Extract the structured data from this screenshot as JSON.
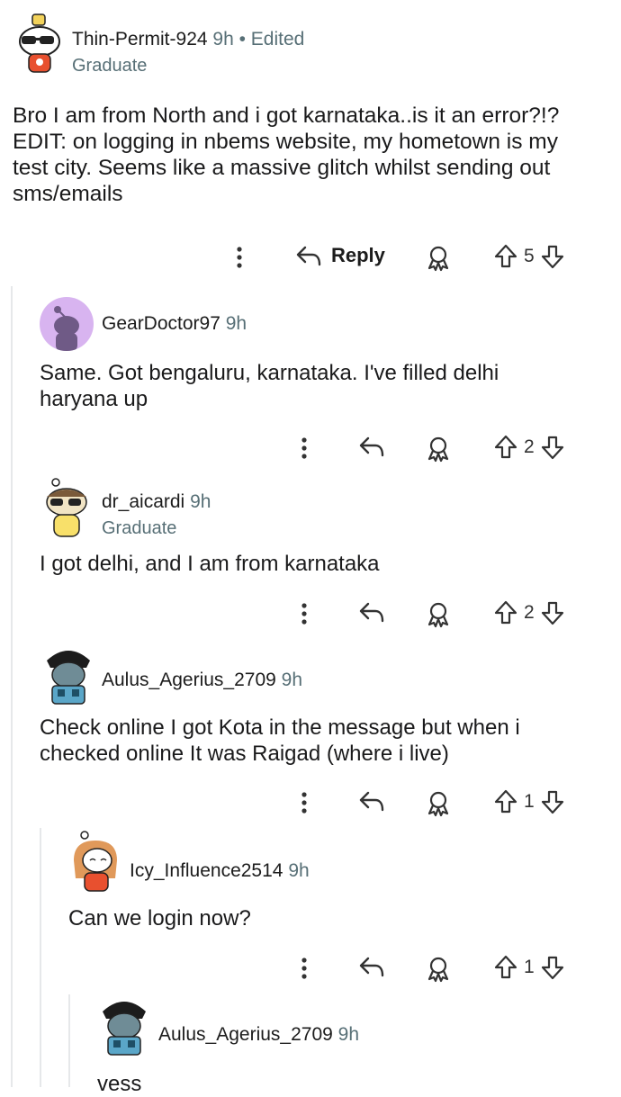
{
  "comments": [
    {
      "username": "Thin-Permit-924",
      "time": "9h",
      "edited": "• Edited",
      "flair": "Graduate",
      "body": "Bro I am from North and i got karnataka..is it an error?!? EDIT: on logging in nbems website, my hometown is my test city. Seems like a massive glitch whilst sending out sms/emails",
      "reply_label": "Reply",
      "votes": "5"
    },
    {
      "username": "GearDoctor97",
      "time": "9h",
      "body": "Same. Got bengaluru, karnataka. I've filled delhi haryana up",
      "votes": "2"
    },
    {
      "username": "dr_aicardi",
      "time": "9h",
      "flair": "Graduate",
      "body": "I got delhi, and I am from karnataka",
      "votes": "2"
    },
    {
      "username": "Aulus_Agerius_2709",
      "time": "9h",
      "body": "Check online I got Kota in the message but when i checked online It was Raigad (where i live)",
      "votes": "1"
    },
    {
      "username": "Icy_Influence2514",
      "time": "9h",
      "body": "Can we login now?",
      "votes": "1"
    },
    {
      "username": "Aulus_Agerius_2709",
      "time": "9h",
      "body": "vess"
    }
  ],
  "colors": {
    "thread_line": "#e6e8ea",
    "meta_text": "#576f76",
    "avatar_purple": "#d8b4f0"
  },
  "icons": [
    "more-options-icon",
    "reply-arrow-icon",
    "award-icon",
    "upvote-icon",
    "downvote-icon"
  ]
}
